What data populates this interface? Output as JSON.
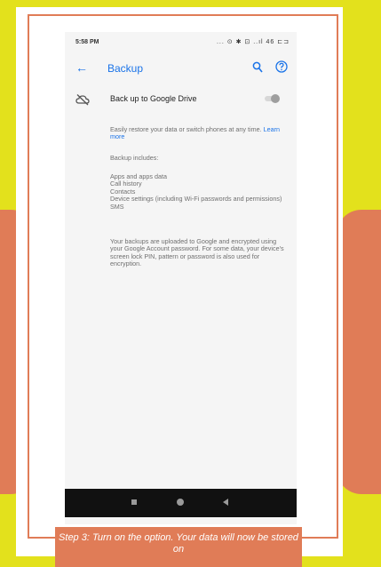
{
  "status_bar": {
    "time": "5:58 PM",
    "icons_text": "... ⊙ ✱ ⊡ ..ıl 46 ⊏⊐"
  },
  "app_bar": {
    "title": "Backup"
  },
  "backup_row": {
    "label": "Back up to Google Drive",
    "toggle_state": "off"
  },
  "body": {
    "description": "Easily restore your data or switch phones at any time.",
    "learn_more": "Learn more",
    "includes_heading": "Backup includes:",
    "includes_items": [
      "Apps and apps data",
      "Call history",
      "Contacts",
      "Device settings (including Wi-Fi passwords and permissions)",
      "SMS"
    ],
    "encryption_note": "Your backups are uploaded to Google and encrypted using your Google Account password. For some data, your device's screen lock PIN, pattern or password is also used for encryption."
  },
  "caption": {
    "text": "Step 3: Turn on the option. Your data will now be stored on"
  },
  "colors": {
    "background": "#e3e11c",
    "accent": "#e07c57",
    "link": "#1a73e8"
  },
  "icons": [
    "back-arrow-icon",
    "search-icon",
    "help-icon",
    "cloud-off-icon",
    "nav-recents-icon",
    "nav-home-icon",
    "nav-back-icon"
  ]
}
